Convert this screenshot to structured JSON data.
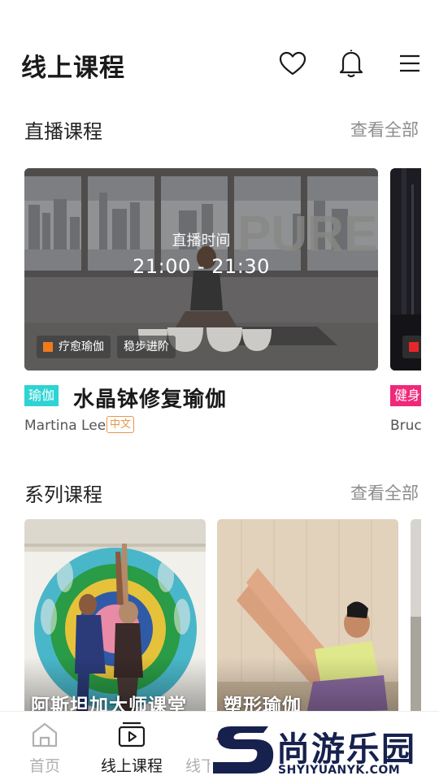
{
  "header": {
    "title": "线上课程",
    "icons": [
      "heart-icon",
      "bell-icon",
      "menu-icon"
    ]
  },
  "live_section": {
    "title": "直播课程",
    "more": "查看全部",
    "cards": [
      {
        "live_label": "直播时间",
        "time": "21:00 - 21:30",
        "tags": [
          "疗愈瑜伽",
          "稳步进阶"
        ],
        "category": "瑜伽",
        "category_color": "#2ed3d3",
        "name": "水晶钵修复瑜伽",
        "instructor": "Martina Lee",
        "language": "中文"
      },
      {
        "category": "健身",
        "category_color": "#f0287a",
        "instructor": "Bruc"
      }
    ]
  },
  "series_section": {
    "title": "系列课程",
    "more": "查看全部",
    "cards": [
      {
        "title": "阿斯坦加大师课堂"
      },
      {
        "title": "塑形瑜伽"
      },
      {
        "title": ""
      }
    ]
  },
  "tabbar": {
    "tabs": [
      {
        "label": "首页",
        "icon": "home-icon",
        "active": false
      },
      {
        "label": "线上课程",
        "icon": "play-icon",
        "active": true
      },
      {
        "label": "线下",
        "icon": "location-icon",
        "active": false
      }
    ]
  },
  "watermark": {
    "text": "尚游乐园",
    "url": "SHYIYUANYK.COM"
  },
  "colors": {
    "accent_orange": "#f07a1e",
    "live_tag_red": "#e8252b",
    "lang_badge": "#e8964a"
  }
}
